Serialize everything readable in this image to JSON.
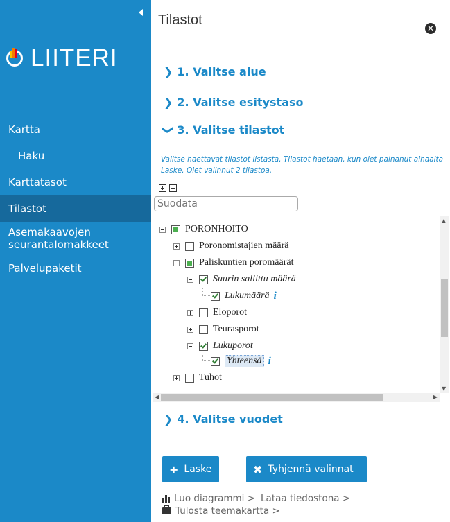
{
  "app": {
    "logo_text": "LIITERI",
    "title": "Tilastot"
  },
  "sidebar": {
    "items": [
      {
        "label": "Kartta"
      },
      {
        "label": "Haku"
      },
      {
        "label": "Karttatasot"
      },
      {
        "label": "Tilastot"
      },
      {
        "label": "Asemakaavojen seurantalomakkeet"
      },
      {
        "label": "Palvelupaketit"
      }
    ]
  },
  "steps": [
    {
      "label": "1. Valitse alue",
      "expanded": false
    },
    {
      "label": "2. Valitse esitystaso",
      "expanded": false
    },
    {
      "label": "3. Valitse tilastot",
      "expanded": true
    },
    {
      "label": "4. Valitse vuodet",
      "expanded": false
    }
  ],
  "hint": "Valitse haettavat tilastot listasta. Tilastot haetaan, kun olet painanut alhaalta Laske. Olet valinnut 2 tilastoa.",
  "filter": {
    "placeholder": "Suodata"
  },
  "tree": [
    {
      "label": "PORONHOITO",
      "state": "partial",
      "expander": "minus"
    },
    {
      "label": "Poronomistajien määrä",
      "state": "empty",
      "expander": "plus"
    },
    {
      "label": "Paliskuntien poromäärät",
      "state": "partial",
      "expander": "minus"
    },
    {
      "label": "Suurin sallittu määrä",
      "state": "checked",
      "expander": "minus"
    },
    {
      "label": "Lukumäärä",
      "state": "checked",
      "info": "i"
    },
    {
      "label": "Eloporot",
      "state": "empty",
      "expander": "plus"
    },
    {
      "label": "Teurasporot",
      "state": "empty",
      "expander": "plus"
    },
    {
      "label": "Lukuporot",
      "state": "checked",
      "expander": "minus"
    },
    {
      "label": "Yhteensä",
      "state": "checked",
      "info": "i",
      "selected": true
    },
    {
      "label": "Tuhot",
      "state": "empty",
      "expander": "plus"
    }
  ],
  "buttons": {
    "compute": "Laske",
    "clear": "Tyhjennä valinnat"
  },
  "links": {
    "diagram": "Luo diagrammi >",
    "download": "Lataa tiedostona >",
    "print": "Tulosta teemakartta >"
  },
  "colors": {
    "accent": "#1b89c8",
    "sidebar_active": "#16699c",
    "check_green": "#4caf50"
  }
}
